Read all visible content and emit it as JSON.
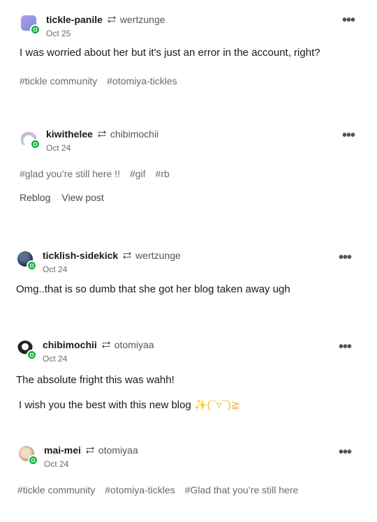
{
  "posts": [
    {
      "author": "tickle-panile",
      "reblog_icon": "reblog-icon",
      "source": "wertzunge",
      "date": "Oct 25",
      "avatar_color": "#8e7bd6",
      "text": "I was worried about her but it's just an error in the account, right?",
      "tags": [
        "#tickle community",
        "#otomiya-tickles"
      ]
    },
    {
      "author": "kiwithelee",
      "reblog_icon": "reblog-icon",
      "source": "chibimochii",
      "date": "Oct 24",
      "avatar_color": "#cfe8f5",
      "tags": [
        "#glad you’re still here !!",
        "#gif",
        "#rb"
      ],
      "actions": [
        "Reblog",
        "View post"
      ]
    },
    {
      "author": "ticklish-sidekick",
      "reblog_icon": "reblog-icon",
      "source": "wertzunge",
      "date": "Oct 24",
      "avatar_color": "#2b3a55",
      "text": "Omg..that is so dumb that she got her blog taken away ugh"
    },
    {
      "author": "chibimochii",
      "reblog_icon": "reblog-icon",
      "source": "otomiyaa",
      "date": "Oct 24",
      "avatar_color": "#222222",
      "text": "The absolute fright this was wahh!",
      "text2": "I wish you the best with this new blog",
      "emoji": "✨(¯▿¯)≧"
    },
    {
      "author": "mai-mei",
      "reblog_icon": "reblog-icon",
      "source": "otomiyaa",
      "date": "Oct 24",
      "avatar_color": "#d9c2a8",
      "tags": [
        "#tickle community",
        "#otomiya-tickles",
        "#Glad that you’re still here"
      ]
    }
  ],
  "more_label": "•••",
  "badge_color": "#19b34a"
}
